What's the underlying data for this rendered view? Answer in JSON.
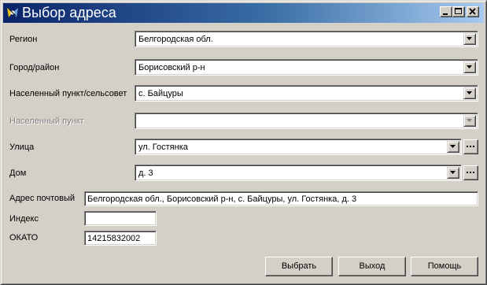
{
  "window": {
    "title": "Выбор адреса",
    "icon": "app-icon",
    "controls": [
      "minimize-icon",
      "maximize-icon",
      "close-icon"
    ]
  },
  "colors": {
    "titlebar_start": "#0a246a",
    "titlebar_end": "#a6caf0",
    "face": "#d4d0c8",
    "disabled_text": "#808080"
  },
  "fields": {
    "region": {
      "label": "Регион",
      "value": "Белгородская обл."
    },
    "city": {
      "label": "Город/район",
      "value": "Борисовский р-н"
    },
    "settlement": {
      "label": "Населенный пункт/сельсовет",
      "value": "с. Байцуры"
    },
    "locality": {
      "label": "Населенный пункт",
      "value": "",
      "disabled": true
    },
    "street": {
      "label": "Улица",
      "value": "ул. Гостянка",
      "browse": "..."
    },
    "house": {
      "label": "Дом",
      "value": "д. 3",
      "browse": "..."
    },
    "postal_address": {
      "label": "Адрес почтовый",
      "value": "Белгородская обл., Борисовский р-н, с. Байцуры, ул. Гостянка, д. 3"
    },
    "index": {
      "label": "Индекс",
      "value": ""
    },
    "okato": {
      "label": "ОКАТО",
      "value": "14215832002"
    }
  },
  "buttons": {
    "select": "Выбрать",
    "exit": "Выход",
    "help": "Помощь"
  }
}
